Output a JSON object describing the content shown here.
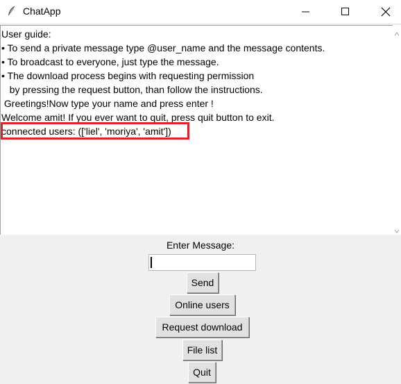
{
  "window": {
    "title": "ChatApp",
    "app_icon": "feather-icon",
    "controls": [
      "minimize-icon",
      "maximize-icon",
      "close-icon"
    ]
  },
  "chat_log": {
    "lines": [
      "User guide:",
      "• To send a private message type @user_name and the message contents.",
      "• To broadcast to everyone, just type the message.",
      "• The download process begins with requesting permission",
      "   by pressing the request button, than follow the instructions.",
      " Greetings!Now type your name and press enter !",
      "Welcome amit! If you ever want to quit, press quit button to exit.",
      "connected users: (['liel', 'moriya', 'amit'])"
    ],
    "highlight_color": "#e0202a"
  },
  "message": {
    "label": "Enter Message:",
    "value": ""
  },
  "buttons": {
    "send": "Send",
    "online_users": "Online users",
    "request_download": "Request download",
    "file_list": "File list",
    "quit": "Quit"
  }
}
